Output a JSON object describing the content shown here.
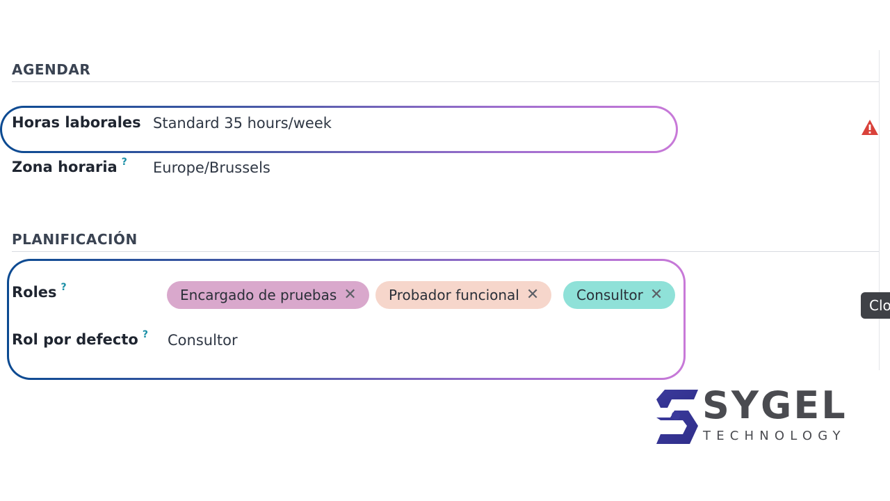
{
  "agendar": {
    "title": "AGENDAR",
    "working_hours_label": "Horas laborales",
    "working_hours_value": "Standard 35 hours/week",
    "timezone_label": "Zona horaria",
    "timezone_help": "?",
    "timezone_value": "Europe/Brussels"
  },
  "planificacion": {
    "title": "PLANIFICACIÓN",
    "roles_label": "Roles",
    "roles_help": "?",
    "roles": [
      {
        "label": "Encargado de pruebas",
        "remove": "✕",
        "color": "#d9a8cc"
      },
      {
        "label": "Probador funcional",
        "remove": "✕",
        "color": "#f6d6cb"
      },
      {
        "label": "Consultor",
        "remove": "✕",
        "color": "#8fe1d8"
      }
    ],
    "default_role_label": "Rol por defecto",
    "default_role_help": "?",
    "default_role_value": "Consultor"
  },
  "warning_icon": "warning-triangle-icon",
  "warning_color": "#d9413a",
  "tooltip_text": "Clo",
  "logo": {
    "name": "SYGEL",
    "tagline": "TECHNOLOGY"
  }
}
